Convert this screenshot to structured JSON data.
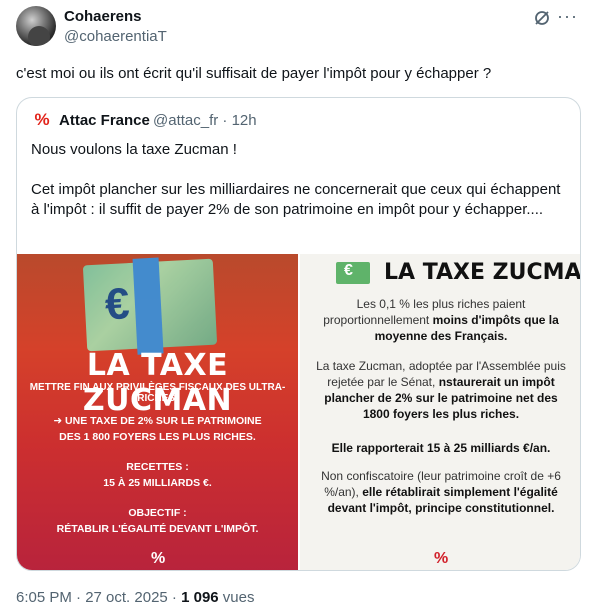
{
  "author": {
    "name": "Cohaerens",
    "handle": "@cohaerentiaT"
  },
  "tweet": {
    "text": "c'est moi ou ils ont écrit qu'il suffisait de payer l'impôt pour y échapper ?"
  },
  "quoted": {
    "name": "Attac France",
    "meta": "@attac_fr · 12h",
    "paragraphs": [
      "Nous voulons la taxe Zucman !",
      "Cet impôt plancher sur les milliardaires ne concernerait que ceux qui échappent à l'impôt : il suffit de payer 2% de son patrimoine en impôt pour y échapper...."
    ],
    "logo_glyph": "%"
  },
  "media_left": {
    "title": "LA TAXE ZUCMAN",
    "subtitle": "METTRE FIN AUX PRIVILÈGES FISCAUX DES ULTRA-RICHES.",
    "line1": "➜ UNE TAXE DE 2% SUR LE PATRIMOINE",
    "line2": "DES 1 800 FOYERS LES PLUS RICHES.",
    "line3": "RECETTES :",
    "line4": "15 À 25 MILLIARDS €.",
    "line5": "OBJECTIF :",
    "line6": "RÉTABLIR L'ÉGALITÉ DEVANT L'IMPÔT.",
    "mark": "%"
  },
  "media_right": {
    "title": "LA TAXE ZUCMAN",
    "p1a": "Les 0,1 % les plus riches paient proportionnellement ",
    "p1b": "moins d'impôts que la moyenne des Français.",
    "p2a": "La taxe Zucman, adoptée par l'Assemblée puis rejetée par le Sénat, ",
    "p2b": "nstaurerait un impôt plancher de 2% sur le patrimoine net des 1800 foyers les plus riches.",
    "p3": "Elle rapporterait 15 à 25 milliards €/an.",
    "p4a": "Non confiscatoire (leur patrimoine croît de +6 %/an), ",
    "p4b": "elle rétablirait simplement l'égalité devant l'impôt, principe constitutionnel.",
    "mark": "%"
  },
  "footer": {
    "time": "6:05 PM · 27 oct. 2025 · ",
    "views_count": "1 096",
    "views_label": " vues"
  },
  "colors": {
    "text": "#0f1419",
    "muted": "#536471",
    "border": "#cfd9de",
    "brand_red": "#e2231a"
  }
}
